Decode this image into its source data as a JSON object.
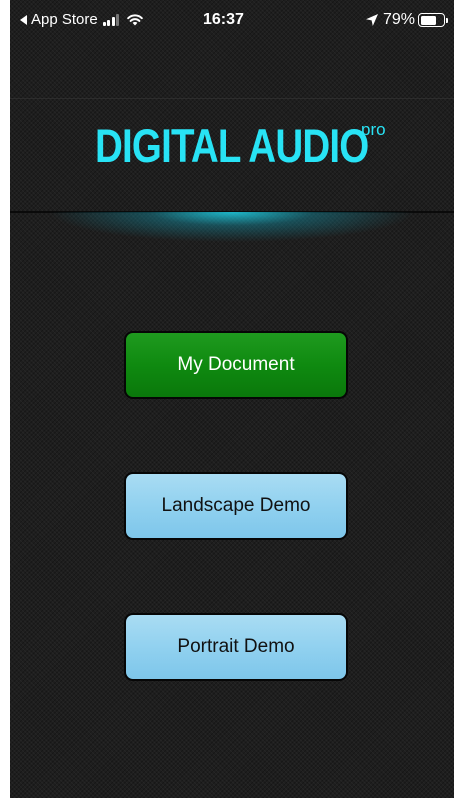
{
  "status_bar": {
    "back_app": "App Store",
    "time": "16:37",
    "battery": "79%",
    "battery_level": 0.79
  },
  "logo": {
    "title": "DIGITAL AUDIO",
    "suffix": "pro",
    "color": "#28e3f5"
  },
  "buttons": {
    "my_document": "My Document",
    "landscape_demo": "Landscape Demo",
    "portrait_demo": "Portrait Demo"
  },
  "colors": {
    "primary_button": "#0f8a10",
    "secondary_button": "#8fd0ef"
  }
}
